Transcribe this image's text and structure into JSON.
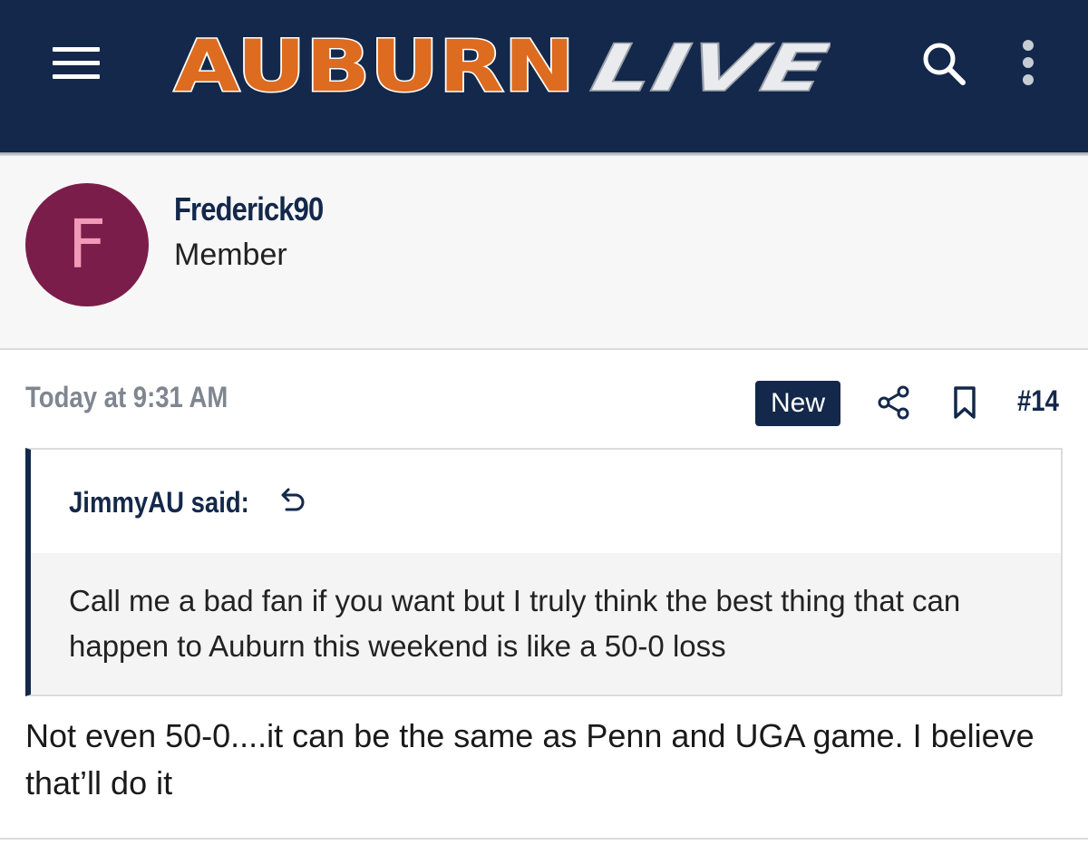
{
  "header": {
    "logo": {
      "primary": "AUBURN",
      "secondary": "LIVE"
    },
    "menu_icon": "hamburger-menu-icon",
    "search_icon": "search-icon",
    "more_icon": "more-vertical-icon"
  },
  "post": {
    "author": {
      "avatar_letter": "F",
      "username": "Frederick90",
      "title": "Member"
    },
    "timestamp": "Today at 9:31 AM",
    "badge": "New",
    "share_icon": "share-icon",
    "bookmark_icon": "bookmark-icon",
    "number": "#14",
    "quote": {
      "author_line": "JimmyAU said:",
      "jump_icon": "jump-to-quote-icon",
      "text": "Call me a bad fan if you want but I truly think the best thing that can happen to Auburn this weekend is like a 50-0 loss"
    },
    "body": "Not even 50-0....it can be the same as Penn and UGA game. I believe that’ll do it"
  },
  "colors": {
    "navy": "#13284a",
    "orange": "#dd6b20",
    "avatar_bg": "#7b1d4a",
    "avatar_letter": "#f09ab8"
  }
}
